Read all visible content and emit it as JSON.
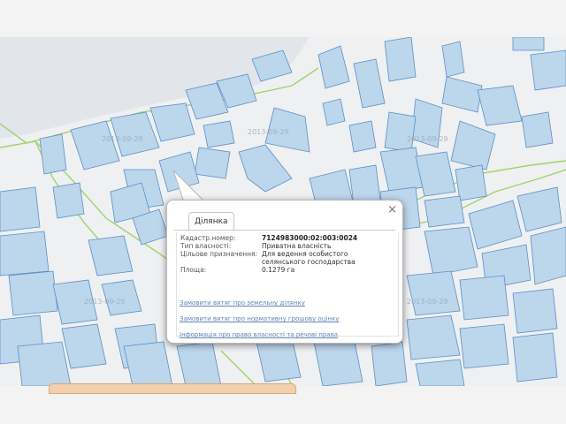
{
  "map": {
    "watermark": "2013-09-29",
    "colors": {
      "parcel_fill": "#bcd6ec",
      "parcel_stroke": "#5b8fc4",
      "road": "#a3d26a"
    }
  },
  "popup": {
    "tab_label": "Ділянка",
    "close_glyph": "×",
    "fields": [
      {
        "label": "Кадастр.номер:",
        "value": "7124983000:02:003:0024"
      },
      {
        "label": "Тип власності:",
        "value": "Приватна власність"
      },
      {
        "label": "Цільове призначення:",
        "value": "Для ведення особистого селянського господарства"
      },
      {
        "label": "Площа:",
        "value": "0.1279 га"
      }
    ],
    "links": [
      "Замовити витяг про земельну ділянку",
      "Замовити витяг про нормативну грошову оцінку",
      "Інформація про право власності та речові права"
    ]
  }
}
